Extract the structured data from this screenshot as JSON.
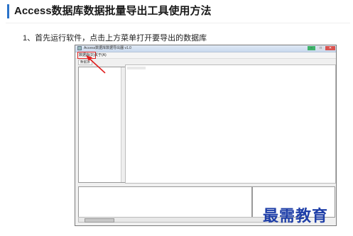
{
  "article": {
    "title": "Access数据库数据批量导出工具使用方法",
    "step1": "1、首先运行软件，点击上方菜单打开要导出的数据库"
  },
  "app": {
    "window_title": "Access数据库数据导出器 v1.0",
    "menu": {
      "database": "数据库(D)",
      "about": "关于(A)"
    },
    "tab": "数据源"
  },
  "colors": {
    "accent_bar": "#2a73c9",
    "highlight": "#e02020",
    "watermark": "#1f3fa8"
  },
  "watermark": "最需教育"
}
